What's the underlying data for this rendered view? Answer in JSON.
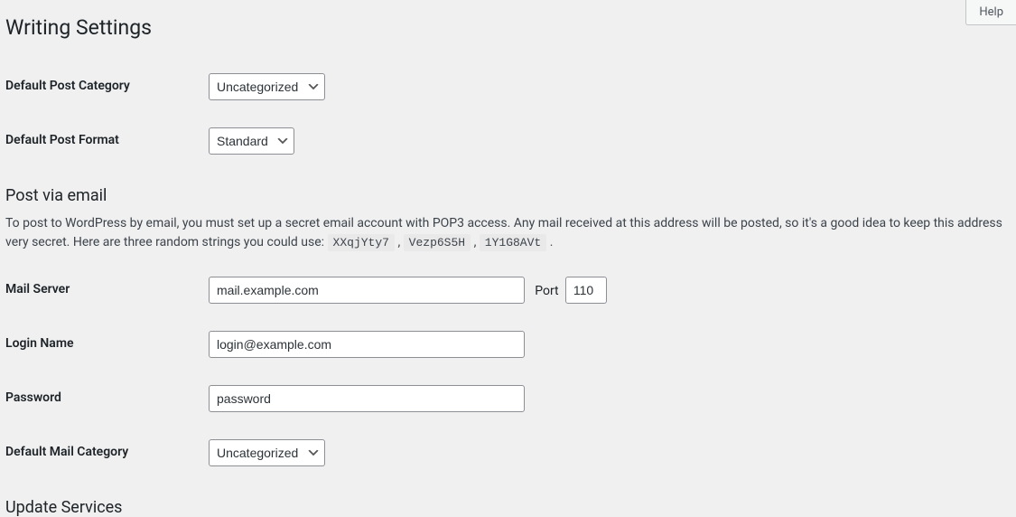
{
  "help": {
    "label": "Help"
  },
  "page": {
    "title": "Writing Settings"
  },
  "defaults": {
    "category_label": "Default Post Category",
    "category_value": "Uncategorized",
    "format_label": "Default Post Format",
    "format_value": "Standard"
  },
  "postEmail": {
    "heading": "Post via email",
    "desc_prefix": "To post to WordPress by email, you must set up a secret email account with POP3 access. Any mail received at this address will be posted, so it's a good idea to keep this address very secret. Here are three random strings you could use: ",
    "rand1": "XXqjYty7",
    "rand2": "Vezp6S5H",
    "rand3": "1Y1G8AVt",
    "mail_server_label": "Mail Server",
    "mail_server_value": "mail.example.com",
    "port_label": "Port",
    "port_value": "110",
    "login_label": "Login Name",
    "login_value": "login@example.com",
    "password_label": "Password",
    "password_value": "password",
    "mail_category_label": "Default Mail Category",
    "mail_category_value": "Uncategorized"
  },
  "updateServices": {
    "heading": "Update Services"
  }
}
